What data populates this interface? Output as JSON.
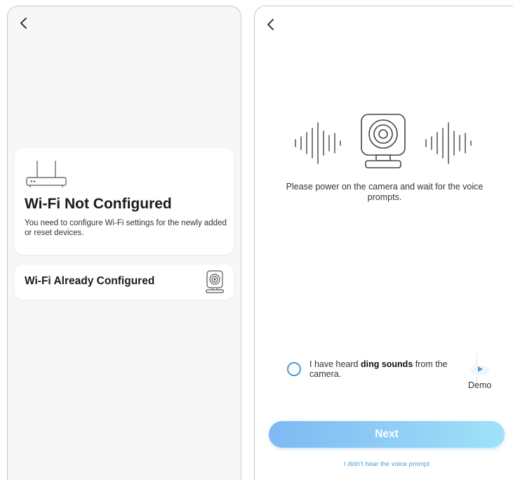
{
  "left_screen": {
    "back_icon": "chevron-left",
    "card_not_configured": {
      "title": "Wi-Fi Not Configured",
      "description": "You need to configure Wi-Fi settings for the newly added or reset devices."
    },
    "card_configured": {
      "title": "Wi-Fi Already Configured"
    }
  },
  "right_screen": {
    "back_icon": "chevron-left",
    "prompt": "Please power on the camera and wait for the voice prompts.",
    "heard": {
      "prefix": "I have heard ",
      "bold": "ding sounds",
      "suffix": " from the camera."
    },
    "demo_label": "Demo",
    "next_label": "Next",
    "no_prompt_link": "I didn't hear the voice prompt"
  },
  "colors": {
    "accent_blue": "#4a9ad8",
    "next_gradient_start": "#7fb8f4",
    "next_gradient_end": "#9ee3f8",
    "link": "#4aa0d6"
  }
}
